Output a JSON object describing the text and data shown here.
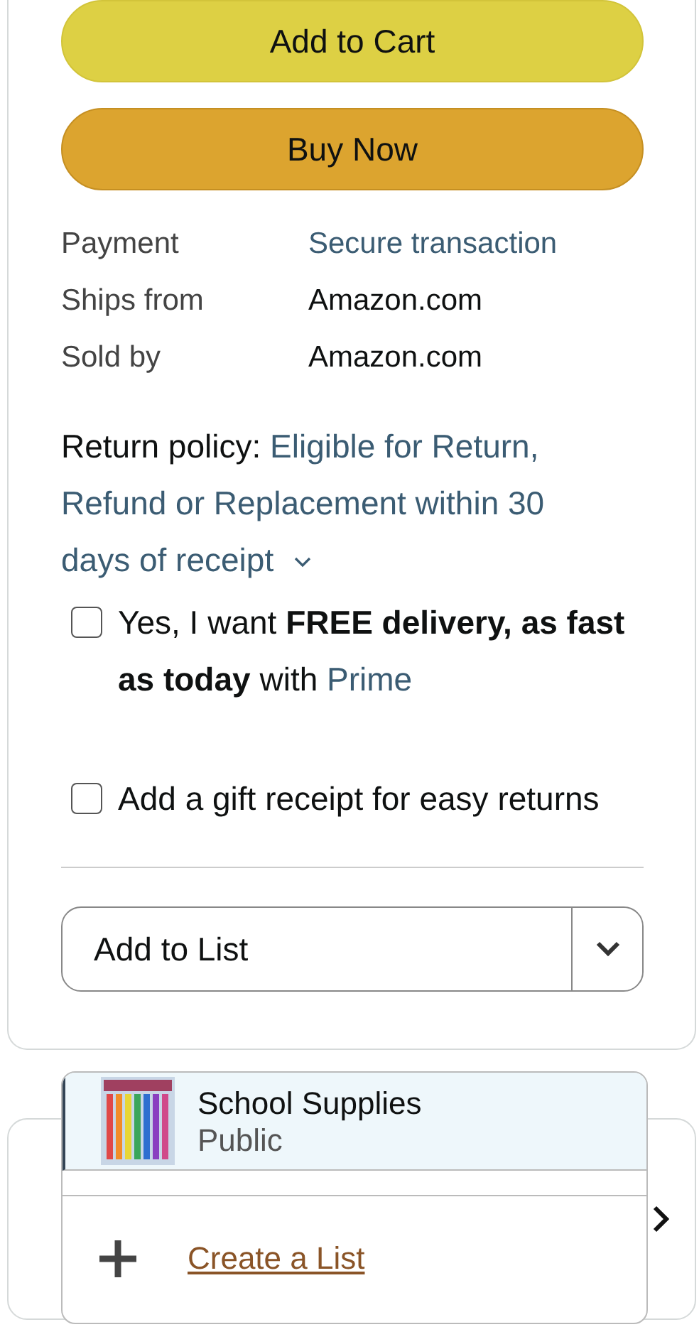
{
  "buttons": [
    {
      "kind": "cart",
      "label": "Add to Cart"
    },
    {
      "kind": "buy",
      "label": "Buy Now"
    }
  ],
  "details": [
    {
      "label": "Payment",
      "value": "Secure transaction",
      "link": true
    },
    {
      "label": "Ships from",
      "value": "Amazon.com",
      "link": false
    },
    {
      "label": "Sold by",
      "value": "Amazon.com",
      "link": false
    }
  ],
  "return_policy": {
    "label": "Return policy:",
    "link": "Eligible for Return, Refund or Replacement within 30 days of receipt",
    "expanded": false
  },
  "options": [
    {
      "text": "Yes, I want **FREE delivery, as fast as today** with",
      "link": "Prime",
      "checked": false
    },
    {
      "text": "Add a gift receipt for easy returns",
      "checked": false
    }
  ],
  "add_to_list": {
    "label": "Add to List",
    "expanded": true
  },
  "list_menu": {
    "lists": [
      {
        "name": "School Supplies",
        "privacy": "Public",
        "selected": true
      }
    ],
    "create_label": "Create a List"
  }
}
